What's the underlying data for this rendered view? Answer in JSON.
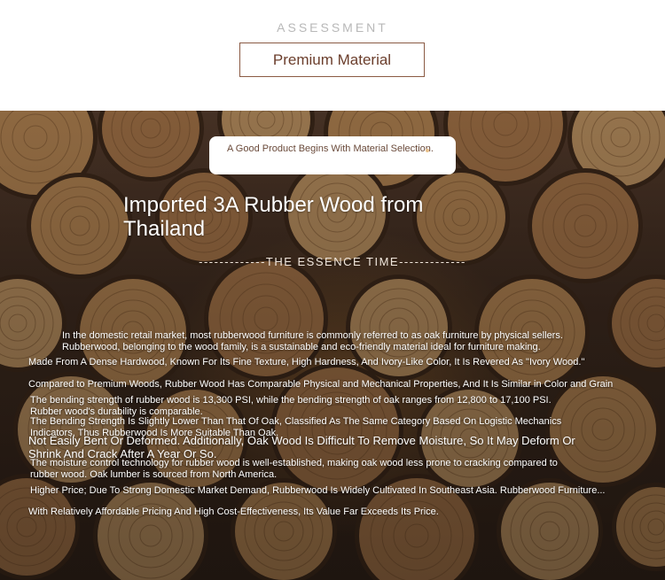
{
  "header": {
    "eyebrow": "ASSESSMENT",
    "title": "Premium Material"
  },
  "banner": {
    "tagline": "A Good Product Begins With Material Selection.",
    "headline": "Imported 3A Rubber Wood from Thailand",
    "subheading": "-------------THE ESSENCE TIME-------------"
  },
  "paragraphs": [
    "In the domestic retail market, most rubberwood furniture is commonly referred to as oak furniture by physical sellers.",
    "Rubberwood, belonging to the wood family, is a sustainable and eco-friendly material ideal for furniture making.",
    "Made From A Dense Hardwood, Known For Its Fine Texture, High Hardness, And Ivory-Like Color, It Is Revered As \"Ivory Wood.\"",
    "Compared to Premium Woods, Rubber Wood Has Comparable Physical and Mechanical Properties, And It Is Similar in Color and Grain",
    "The bending strength of rubber wood is 13,300 PSI, while the bending strength of oak ranges from 12,800 to 17,100 PSI.",
    "Rubber wood's durability is comparable.",
    "The Bending Strength Is Slightly Lower Than That Of Oak, Classified As The Same Category Based On Logistic Mechanics",
    "Indicators, Thus Rubberwood Is More Suitable Than Oak.",
    "Not Easily Bent Or Deformed. Additionally, Oak Wood Is Difficult To Remove Moisture, So It May Deform Or",
    "Shrink And Crack After A Year Or So.",
    "The moisture control technology for rubber wood is well-established, making oak wood less prone to cracking compared to",
    "rubber wood. Oak lumber is sourced from North America.",
    "Higher Price; Due To Strong Domestic Market Demand, Rubberwood Is Widely Cultivated In Southeast Asia. Rubberwood Furniture...",
    "With Relatively Affordable Pricing And High Cost-Effectiveness, Its Value Far Exceeds Its Price."
  ],
  "colors": {
    "accent_border": "#8a5a44",
    "title_text": "#6b3e2c",
    "eyebrow_text": "#b8b8b8"
  }
}
